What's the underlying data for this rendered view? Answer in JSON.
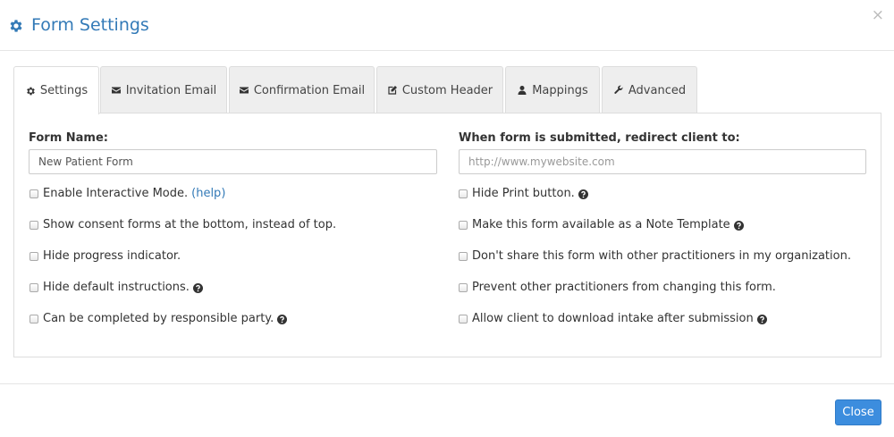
{
  "header": {
    "title": "Form Settings",
    "icon": "gear-icon",
    "close_symbol": "×"
  },
  "tabs": [
    {
      "label": "Settings",
      "icon": "gear-icon",
      "active": true
    },
    {
      "label": "Invitation Email",
      "icon": "envelope-icon"
    },
    {
      "label": "Confirmation Email",
      "icon": "envelope-icon"
    },
    {
      "label": "Custom Header",
      "icon": "edit-icon"
    },
    {
      "label": "Mappings",
      "icon": "user-icon"
    },
    {
      "label": "Advanced",
      "icon": "wrench-icon"
    }
  ],
  "form": {
    "name_label": "Form Name:",
    "name_value": "New Patient Form",
    "redirect_label": "When form is submitted, redirect client to:",
    "redirect_placeholder": "http://www.mywebsite.com"
  },
  "left_options": [
    {
      "label": "Enable Interactive Mode.",
      "help_link": "(help)",
      "checked": false
    },
    {
      "label": "Show consent forms at the bottom, instead of top.",
      "checked": false
    },
    {
      "label": "Hide progress indicator.",
      "checked": false
    },
    {
      "label": "Hide default instructions.",
      "help_icon": "question-circle-icon",
      "checked": false
    },
    {
      "label": "Can be completed by responsible party.",
      "help_icon": "question-circle-icon",
      "checked": false
    }
  ],
  "right_options": [
    {
      "label": "Hide Print button.",
      "help_icon": "question-circle-icon",
      "checked": false
    },
    {
      "label": "Make this form available as a Note Template",
      "help_icon": "question-circle-icon",
      "checked": false
    },
    {
      "label": "Don't share this form with other practitioners in my organization.",
      "checked": false
    },
    {
      "label": "Prevent other practitioners from changing this form.",
      "checked": false
    },
    {
      "label": "Allow client to download intake after submission",
      "help_icon": "question-circle-icon",
      "checked": false
    }
  ],
  "footer": {
    "close_label": "Close"
  },
  "colors": {
    "accent": "#337ab7",
    "button": "#3c8dde"
  }
}
